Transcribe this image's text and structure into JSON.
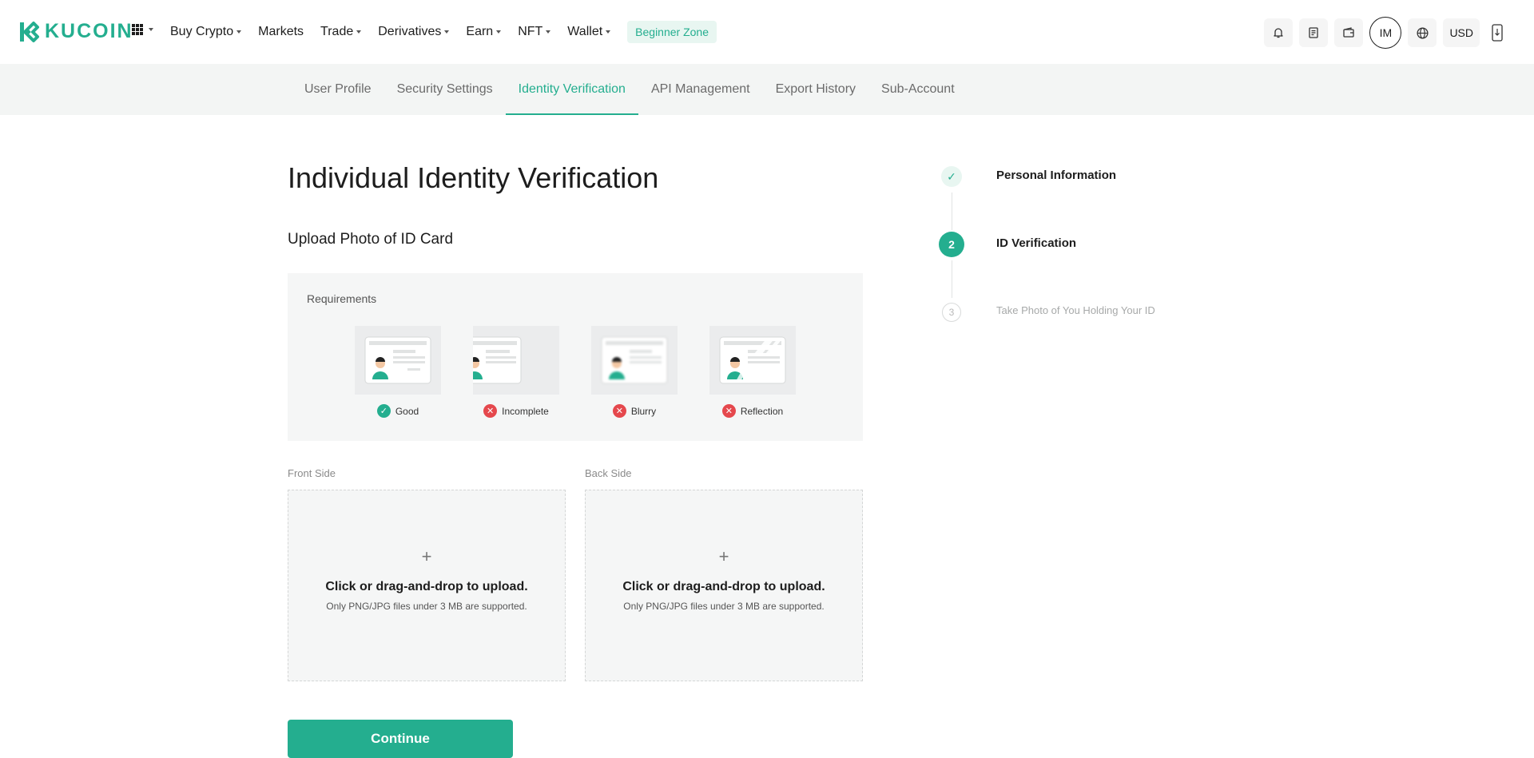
{
  "brand": {
    "name": "KUCOIN",
    "color": "#24ae8f"
  },
  "topnav": {
    "items": [
      {
        "label": "Buy Crypto",
        "has_dropdown": true
      },
      {
        "label": "Markets",
        "has_dropdown": false
      },
      {
        "label": "Trade",
        "has_dropdown": true
      },
      {
        "label": "Derivatives",
        "has_dropdown": true
      },
      {
        "label": "Earn",
        "has_dropdown": true
      },
      {
        "label": "NFT",
        "has_dropdown": true
      },
      {
        "label": "Wallet",
        "has_dropdown": true
      }
    ],
    "beginner_zone": "Beginner Zone",
    "avatar_initials": "IM",
    "currency": "USD",
    "icons": [
      "apps-grid-icon",
      "bell-icon",
      "orders-icon",
      "wallet-icon",
      "globe-icon",
      "download-app-icon"
    ]
  },
  "subnav": {
    "tabs": [
      {
        "label": "User Profile",
        "active": false
      },
      {
        "label": "Security Settings",
        "active": false
      },
      {
        "label": "Identity Verification",
        "active": true
      },
      {
        "label": "API Management",
        "active": false
      },
      {
        "label": "Export History",
        "active": false
      },
      {
        "label": "Sub-Account",
        "active": false
      }
    ]
  },
  "main": {
    "title": "Individual Identity Verification",
    "section_title": "Upload Photo of ID Card",
    "requirements": {
      "label": "Requirements",
      "items": [
        {
          "label": "Good",
          "status": "ok"
        },
        {
          "label": "Incomplete",
          "status": "bad"
        },
        {
          "label": "Blurry",
          "status": "bad"
        },
        {
          "label": "Reflection",
          "status": "bad"
        }
      ]
    },
    "upload": {
      "front": {
        "label": "Front Side",
        "cta": "Click or drag-and-drop to upload.",
        "hint": "Only PNG/JPG files under 3 MB are supported."
      },
      "back": {
        "label": "Back Side",
        "cta": "Click or drag-and-drop to upload.",
        "hint": "Only PNG/JPG files under 3 MB are supported."
      }
    },
    "continue_label": "Continue"
  },
  "stepper": {
    "steps": [
      {
        "label": "Personal Information",
        "state": "done",
        "marker": "✓"
      },
      {
        "label": "ID Verification",
        "state": "current",
        "marker": "2"
      },
      {
        "label": "Take Photo of You Holding Your ID",
        "state": "pending",
        "marker": "3"
      }
    ]
  }
}
